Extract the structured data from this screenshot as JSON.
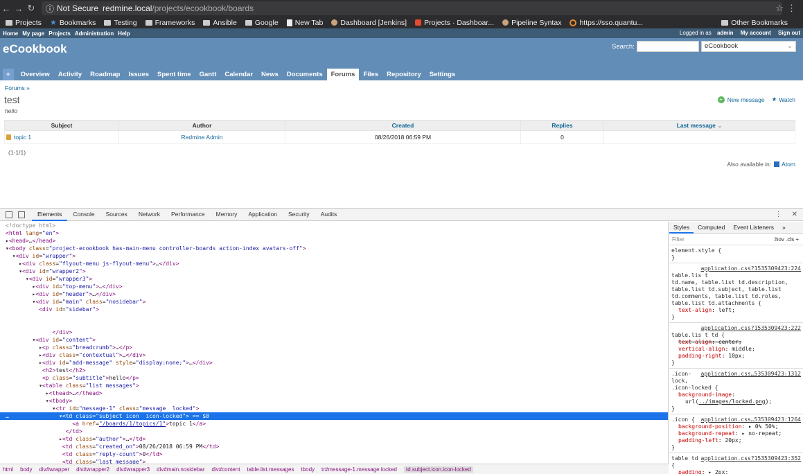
{
  "browser": {
    "security": "Not Secure",
    "url_host": "redmine.local",
    "url_path": "/projects/ecookbook/boards",
    "bookmarks": [
      {
        "label": "Projects",
        "icon": "folder-icon"
      },
      {
        "label": "Bookmarks",
        "icon": "star-icon"
      },
      {
        "label": "Testing",
        "icon": "folder-icon"
      },
      {
        "label": "Frameworks",
        "icon": "folder-icon"
      },
      {
        "label": "Ansible",
        "icon": "folder-icon"
      },
      {
        "label": "Google",
        "icon": "folder-icon"
      },
      {
        "label": "New Tab",
        "icon": "page-icon"
      },
      {
        "label": "Dashboard [Jenkins]",
        "icon": "jenkins-icon"
      },
      {
        "label": "Projects · Dashboar...",
        "icon": "gitlab-icon"
      },
      {
        "label": "Pipeline Syntax",
        "icon": "jenkins-icon"
      },
      {
        "label": "https://sso.quantu...",
        "icon": "ring-icon"
      }
    ],
    "other_bookmarks": "Other Bookmarks"
  },
  "topmenu": {
    "items": [
      "Home",
      "My page",
      "Projects",
      "Administration",
      "Help"
    ],
    "logged_in_prefix": "Logged in as",
    "user": "admin",
    "my_account": "My account",
    "sign_out": "Sign out"
  },
  "header": {
    "project": "eCookbook",
    "search_label": "Search:",
    "jump_value": "eCookbook",
    "tabs": [
      "+",
      "Overview",
      "Activity",
      "Roadmap",
      "Issues",
      "Spent time",
      "Gantt",
      "Calendar",
      "News",
      "Documents",
      "Forums",
      "Files",
      "Repository",
      "Settings"
    ],
    "selected_tab": "Forums"
  },
  "page": {
    "breadcrumb": "Forums »",
    "title": "test",
    "subtitle": "hello",
    "new_message": "New message",
    "watch": "Watch",
    "columns": [
      "Subject",
      "Author",
      "Created",
      "Replies",
      "Last message"
    ],
    "rows": [
      {
        "subject": "topic 1",
        "author": "Redmine Admin",
        "created": "08/26/2018 06:59 PM",
        "replies": "0",
        "last": ""
      }
    ],
    "pagination": "(1-1/1)",
    "also_available": "Also available in:",
    "atom": "Atom"
  },
  "devtools": {
    "tabs": [
      "Elements",
      "Console",
      "Sources",
      "Network",
      "Performance",
      "Memory",
      "Application",
      "Security",
      "Audits"
    ],
    "selected_tab": "Elements",
    "breadcrumbs": [
      "html",
      "body",
      "div#wrapper",
      "div#wrapper2",
      "div#wrapper3",
      "div#main.nosidebar",
      "div#content",
      "table.list.messages",
      "tbody",
      "tr#message-1.message.locked",
      "td.subject.icon.icon-locked"
    ],
    "styles_tabs": [
      "Styles",
      "Computed",
      "Event Listeners",
      "»"
    ],
    "filter_placeholder": "Filter",
    "filter_tools": ":hov  .cls  +"
  }
}
